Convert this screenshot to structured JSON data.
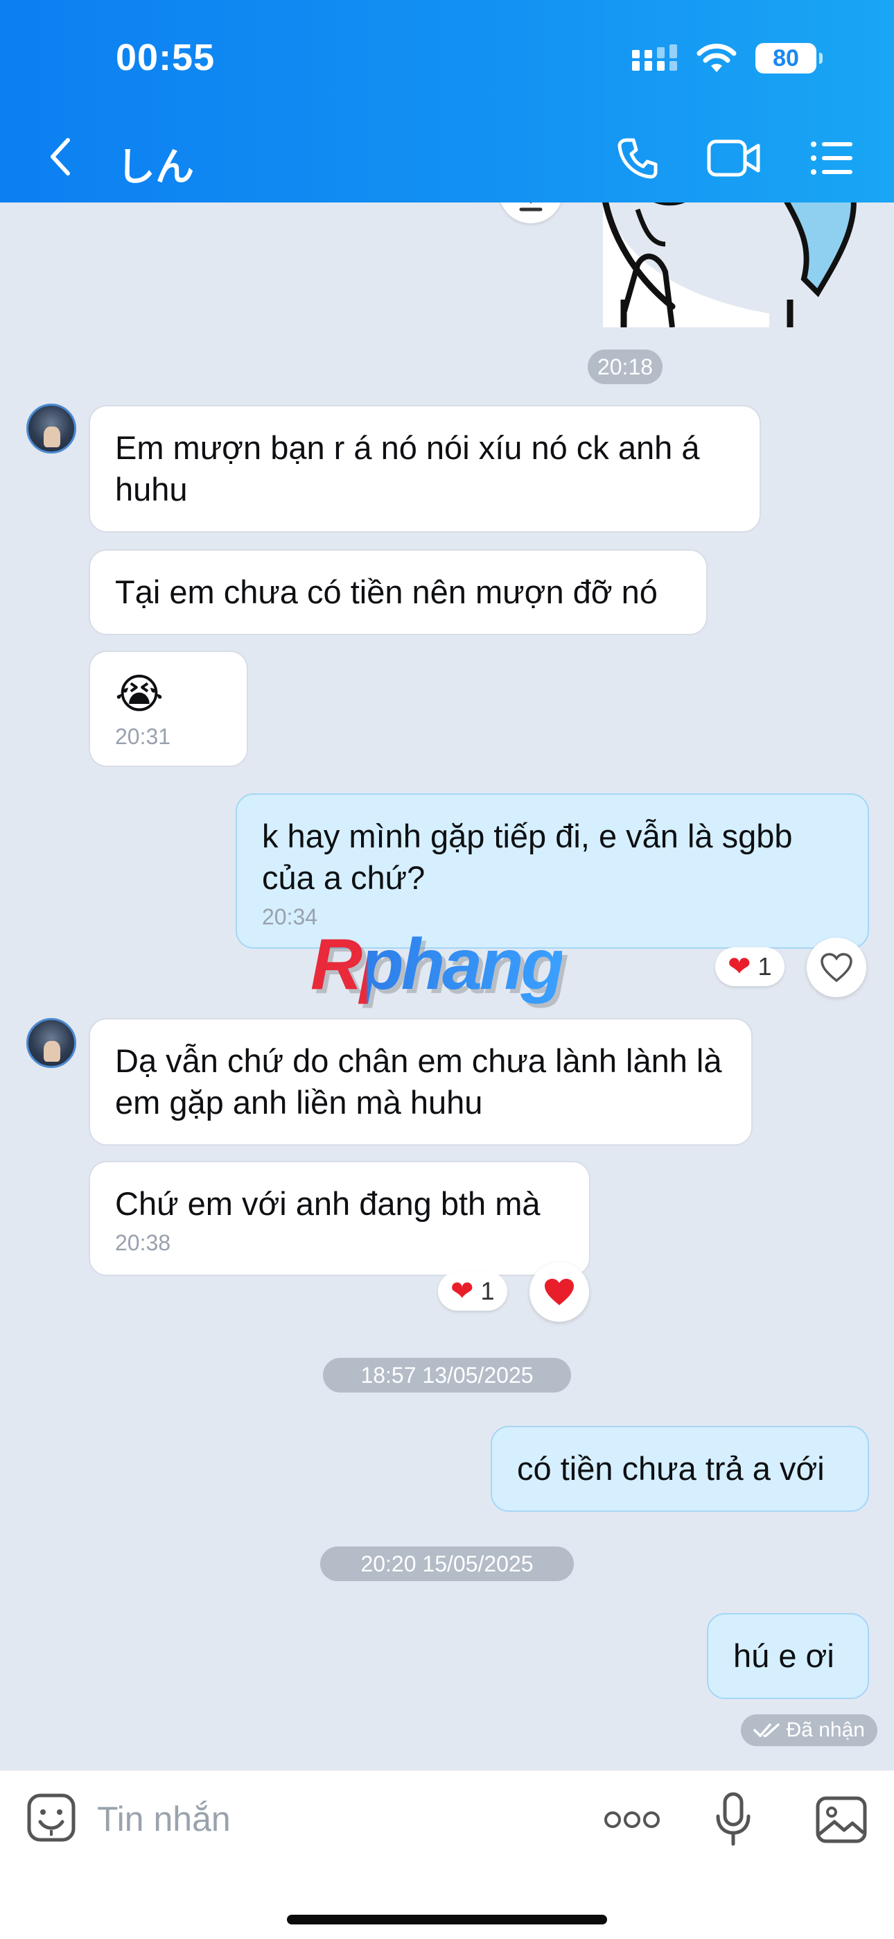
{
  "status_bar": {
    "time": "00:55",
    "battery": "80"
  },
  "header": {
    "contact_name": "しん"
  },
  "messages": {
    "time_1": "20:18",
    "m1_text": "Em mượn bạn r á nó nói xíu nó ck anh á huhu",
    "m2_text": "Tại em chưa có tiền nên mượn đỡ nó",
    "m3_emoji": "😭",
    "m3_time": "20:31",
    "m4_text": "k hay mình gặp tiếp đi, e vẫn là sgbb của a chứ?",
    "m4_time": "20:34",
    "m4_reaction": {
      "emoji": "❤",
      "count": "1"
    },
    "m5_text": "Dạ vẫn chứ do chân em chưa lành lành là em gặp anh liền mà huhu",
    "m6_text": "Chứ em với anh đang bth mà",
    "m6_time": "20:38",
    "m6_reaction": {
      "emoji": "❤",
      "count": "1"
    },
    "divider_1": "18:57 13/05/2025",
    "m7_text": "có tiền chưa trả a với",
    "divider_2": "20:20 15/05/2025",
    "m8_text": "hú e ơi",
    "m8_status": "Đã nhận"
  },
  "watermark": "Rphang",
  "input": {
    "placeholder": "Tin nhắn"
  },
  "colors": {
    "header": "#1493f3",
    "outgoing_bubble": "#d5effe",
    "incoming_bubble": "#ffffff",
    "background": "#e2e8f1",
    "heart": "#e81f2b"
  }
}
